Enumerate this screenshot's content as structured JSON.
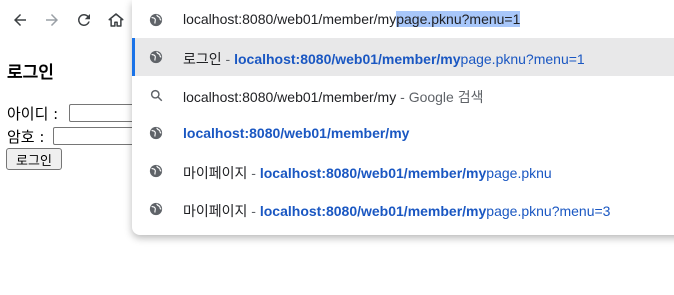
{
  "browser": {
    "omnibox_value_typed": "localhost:8080/web01/member/my",
    "omnibox_value_selected": "page.pknu?menu=1"
  },
  "page": {
    "title": "로그인",
    "id_label": "아이디 :",
    "pw_label": "암호 :",
    "submit_label": "로그인"
  },
  "suggestions": [
    {
      "title": "로그인",
      "sep": " - ",
      "url_bold": "localhost:8080/web01/member/my",
      "url_rest": "page.pknu?menu=1",
      "icon": "globe-icon"
    },
    {
      "title": "localhost:8080/web01/member/my",
      "sep": " - ",
      "note": "Google 검색",
      "icon": "search-icon"
    },
    {
      "url_bold": "localhost:8080/web01/member/my",
      "icon": "globe-icon"
    },
    {
      "title": "마이페이지",
      "sep": " - ",
      "url_bold": "localhost:8080/web01/member/my",
      "url_rest": "page.pknu",
      "icon": "globe-icon"
    },
    {
      "title": "마이페이지",
      "sep": " - ",
      "url_bold": "localhost:8080/web01/member/my",
      "url_rest": "page.pknu?menu=3",
      "icon": "globe-icon"
    }
  ]
}
